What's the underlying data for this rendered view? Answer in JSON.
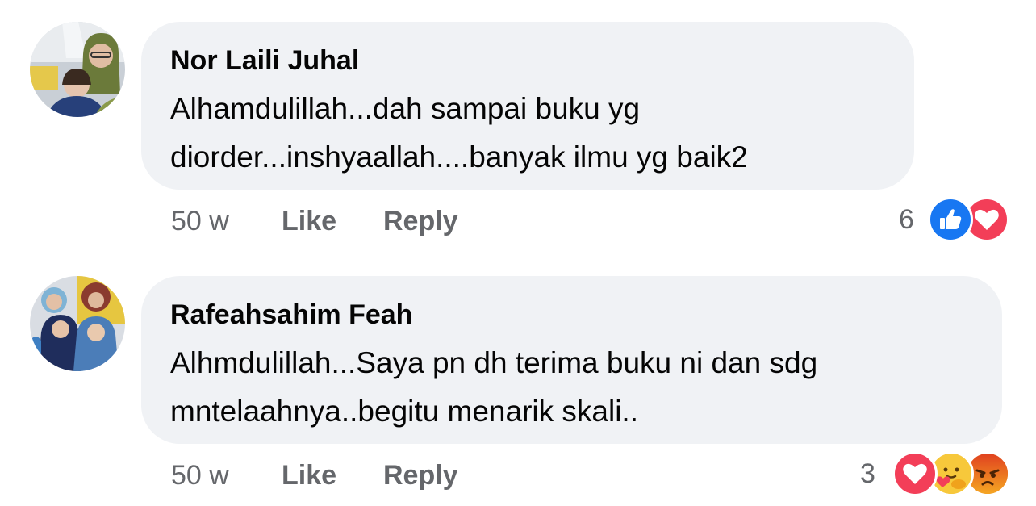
{
  "comments": [
    {
      "author": "Nor Laili Juhal",
      "text_line1": "Alhamdulillah...dah sampai buku yg",
      "text_line2": "diorder...inshyaallah....banyak ilmu yg baik2",
      "time": "50 w",
      "like_label": "Like",
      "reply_label": "Reply",
      "reaction_count": "6",
      "reactions": [
        "like-icon",
        "love-icon"
      ]
    },
    {
      "author": "Rafeahsahim Feah",
      "text_line1": "Alhmdulillah...Saya pn dh terima buku ni dan sdg",
      "text_line2": "mntelaahnya..begitu menarik skali..",
      "time": "50 w",
      "like_label": "Like",
      "reply_label": "Reply",
      "reaction_count": "3",
      "reactions": [
        "love-icon",
        "care-icon",
        "angry-icon"
      ]
    }
  ],
  "colors": {
    "bubble": "#f0f2f5",
    "meta_text": "#65676b",
    "like_blue": "#1877f2",
    "love_red": "#f33e58",
    "angry_orange": "#e9710f",
    "care_yellow": "#f7b125"
  }
}
